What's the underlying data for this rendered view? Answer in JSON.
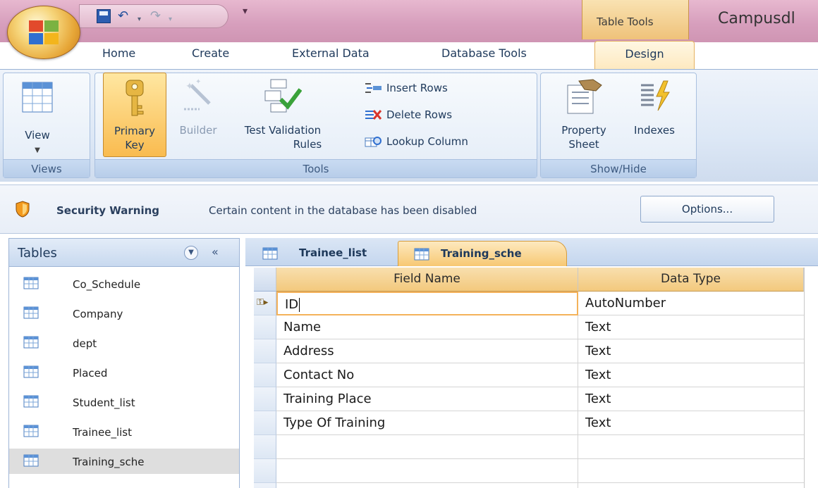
{
  "title_bar": {
    "context_group": "Table Tools",
    "app_title": "Campusdl"
  },
  "ribbon_tabs": {
    "home": "Home",
    "create": "Create",
    "external_data": "External Data",
    "database_tools": "Database Tools",
    "design": "Design"
  },
  "ribbon": {
    "views": {
      "group_label": "Views",
      "view_label": "View"
    },
    "tools": {
      "group_label": "Tools",
      "primary_key_line1": "Primary",
      "primary_key_line2": "Key",
      "builder": "Builder",
      "test_validation_line1": "Test Validation",
      "test_validation_line2": "Rules",
      "insert_rows": "Insert Rows",
      "delete_rows": "Delete Rows",
      "lookup_column": "Lookup Column"
    },
    "show_hide": {
      "group_label": "Show/Hide",
      "property_sheet_line1": "Property",
      "property_sheet_line2": "Sheet",
      "indexes": "Indexes"
    }
  },
  "security_bar": {
    "title": "Security Warning",
    "message": "Certain content in the database has been disabled",
    "options_button": "Options..."
  },
  "nav_pane": {
    "title": "Tables",
    "collapse_glyph": "«",
    "items": [
      {
        "label": "Co_Schedule"
      },
      {
        "label": "Company"
      },
      {
        "label": "dept"
      },
      {
        "label": "Placed"
      },
      {
        "label": "Student_list"
      },
      {
        "label": "Trainee_list"
      },
      {
        "label": "Training_sche"
      }
    ],
    "selected": "Training_sche"
  },
  "document_tabs": [
    {
      "label": "Trainee_list"
    },
    {
      "label": "Training_sche"
    }
  ],
  "active_tab": "Training_sche",
  "design_grid": {
    "headers": {
      "field_name": "Field Name",
      "data_type": "Data Type"
    },
    "rows": [
      {
        "field": "ID",
        "type": "AutoNumber",
        "primary_key": true
      },
      {
        "field": "Name",
        "type": "Text"
      },
      {
        "field": "Address",
        "type": "Text"
      },
      {
        "field": "Contact No",
        "type": "Text"
      },
      {
        "field": "Training Place",
        "type": "Text"
      },
      {
        "field": "Type Of Training",
        "type": "Text"
      },
      {
        "field": "",
        "type": ""
      },
      {
        "field": "",
        "type": ""
      },
      {
        "field": "",
        "type": ""
      }
    ]
  },
  "colors": {
    "title_bar": "#d79fbd",
    "context_tab": "#f7c873",
    "ribbon": "#dde8f6",
    "accent_border": "#9db4d6"
  }
}
